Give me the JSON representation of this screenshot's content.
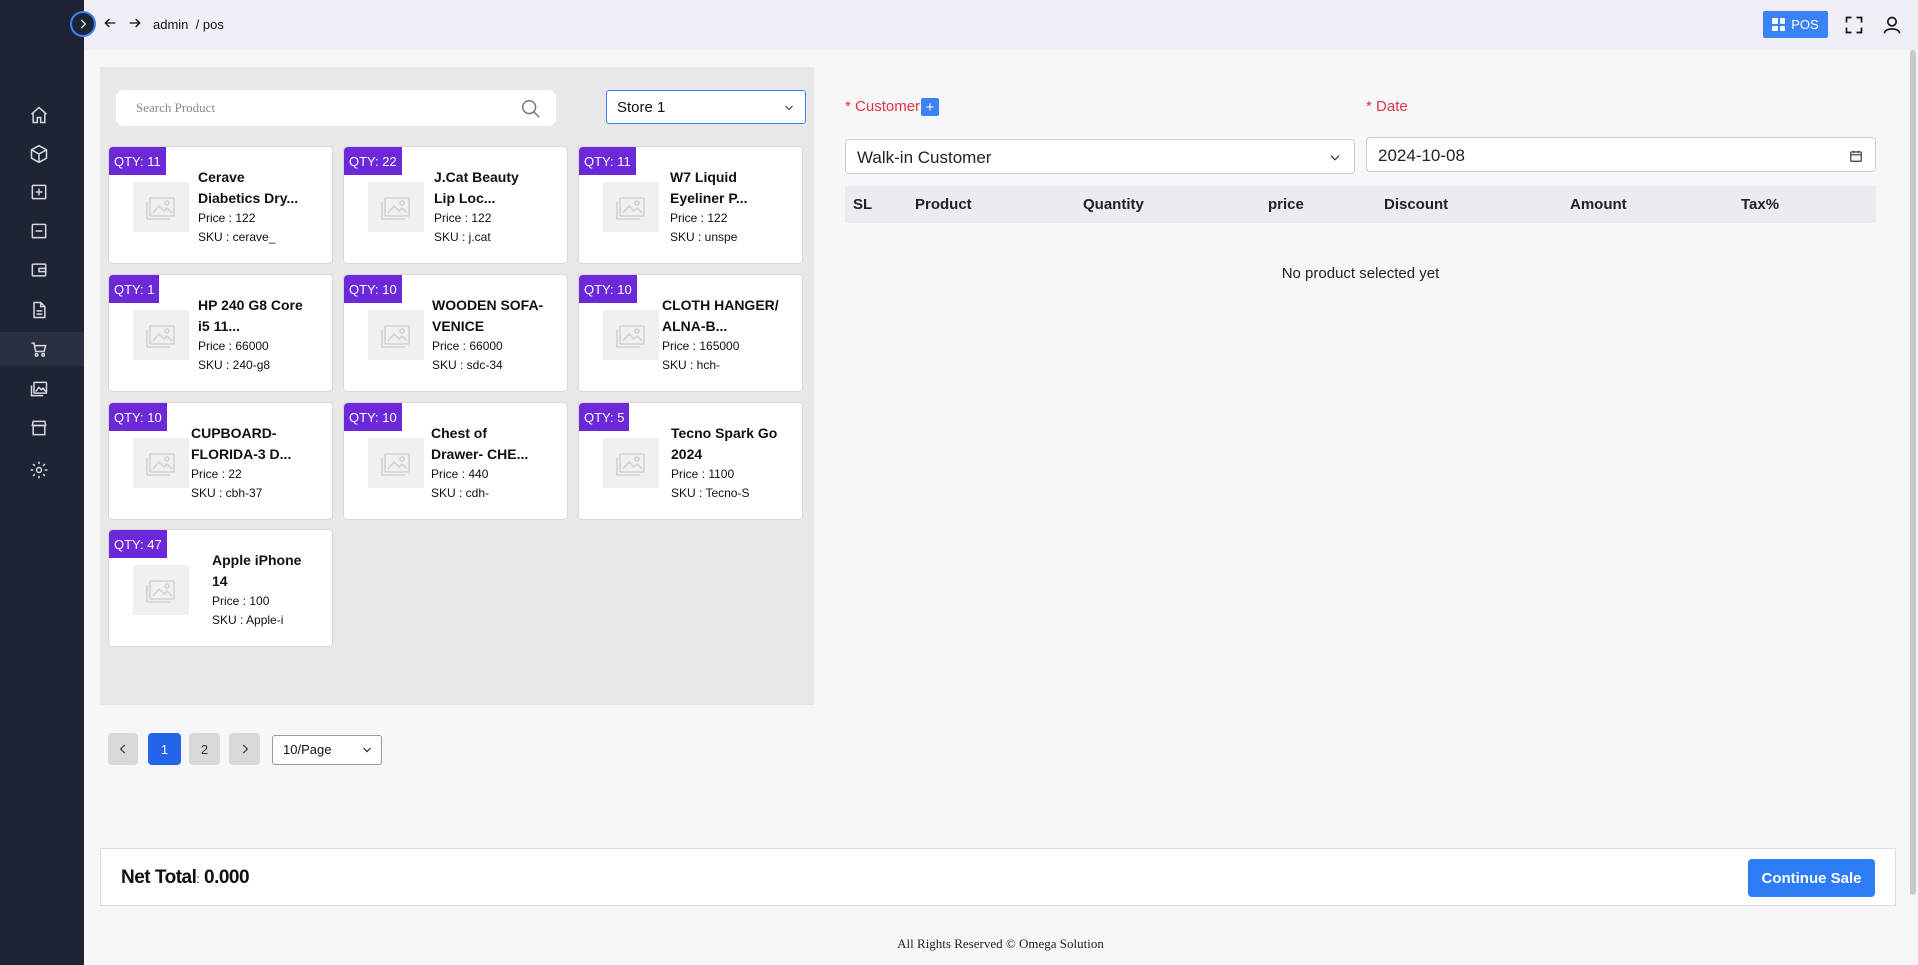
{
  "breadcrumb": {
    "part1": "admin",
    "part2": "/ pos"
  },
  "topbar": {
    "pos_label": "POS"
  },
  "sidebar": {
    "items": [
      {
        "icon": "home-icon"
      },
      {
        "icon": "box-icon"
      },
      {
        "icon": "plus-square-icon"
      },
      {
        "icon": "minus-square-icon"
      },
      {
        "icon": "wallet-icon"
      },
      {
        "icon": "document-icon"
      },
      {
        "icon": "cart-icon"
      },
      {
        "icon": "gallery-icon"
      },
      {
        "icon": "store-icon"
      },
      {
        "icon": "gear-icon"
      }
    ]
  },
  "products": {
    "search_placeholder": "Search Product",
    "store_selected": "Store 1",
    "items": [
      {
        "qty": "QTY: 11",
        "name1": "Cerave",
        "name2": "Diabetics Dry...",
        "price": "Price : 122",
        "sku": "SKU : cerave_"
      },
      {
        "qty": "QTY: 22",
        "name1": "J.Cat Beauty",
        "name2": "Lip Loc...",
        "price": "Price : 122",
        "sku": "SKU : j.cat"
      },
      {
        "qty": "QTY: 11",
        "name1": "W7 Liquid",
        "name2": "Eyeliner P...",
        "price": "Price : 122",
        "sku": "SKU : unspe"
      },
      {
        "qty": "QTY: 1",
        "name1": "HP 240 G8 Core",
        "name2": "i5 11...",
        "price": "Price : 66000",
        "sku": "SKU : 240-g8"
      },
      {
        "qty": "QTY: 10",
        "name1": "WOODEN SOFA-",
        "name2": "VENICE",
        "price": "Price : 66000",
        "sku": "SKU : sdc-34"
      },
      {
        "qty": "QTY: 10",
        "name1": "CLOTH HANGER/",
        "name2": "ALNA-B...",
        "price": "Price : 165000",
        "sku": "SKU : hch-"
      },
      {
        "qty": "QTY: 10",
        "name1": "CUPBOARD-",
        "name2": "FLORIDA-3 D...",
        "price": "Price : 22",
        "sku": "SKU : cbh-37"
      },
      {
        "qty": "QTY: 10",
        "name1": "Chest of",
        "name2": "Drawer- CHE...",
        "price": "Price : 440",
        "sku": "SKU : cdh-"
      },
      {
        "qty": "QTY: 5",
        "name1": "Tecno Spark Go",
        "name2": "2024",
        "price": "Price : 1100",
        "sku": "SKU : Tecno-S"
      },
      {
        "qty": "QTY: 47",
        "name1": "Apple iPhone",
        "name2": "14",
        "price": "Price : 100",
        "sku": "SKU : Apple-i"
      }
    ]
  },
  "pagination": {
    "pages": [
      "1",
      "2"
    ],
    "current": "1",
    "per_page": "10/Page"
  },
  "sale": {
    "customer_label": "Customer",
    "customer_required": "*",
    "date_label": "Date",
    "date_required": "*",
    "plus_label": "+",
    "customer_value": "Walk-in Customer",
    "date_value": "2024-10-08",
    "columns": [
      "SL",
      "Product",
      "Quantity",
      "price",
      "Discount",
      "Amount",
      "Tax%"
    ],
    "empty_message": "No product selected yet"
  },
  "footer": {
    "net_total_label": "Net Total",
    "net_total_colon": ":",
    "net_total_value": "0.000",
    "continue_label": "Continue Sale",
    "copyright": "All Rights Reserved © Omega Solution"
  },
  "colors": {
    "accent": "#3b82f6",
    "badge": "#6d28d9",
    "sidebar": "#1e2433",
    "required": "#dc3545"
  }
}
